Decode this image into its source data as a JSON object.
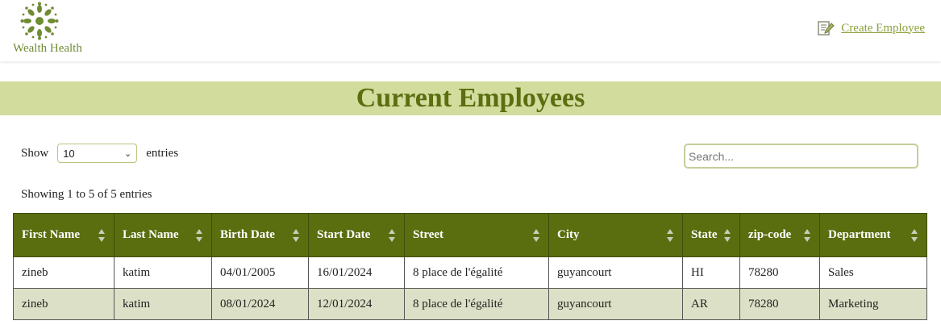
{
  "brand": {
    "name": "Wealth Health"
  },
  "nav": {
    "create_label": "Create Employee"
  },
  "page": {
    "title": "Current Employees"
  },
  "controls": {
    "show_label": "Show",
    "entries_value": "10",
    "entries_label": "entries",
    "search_placeholder": "Search...",
    "showing_text": "Showing 1 to 5 of 5 entries"
  },
  "table": {
    "columns": [
      "First Name",
      "Last Name",
      "Birth Date",
      "Start Date",
      "Street",
      "City",
      "State",
      "zip-code",
      "Department"
    ],
    "rows": [
      [
        "zineb",
        "katim",
        "04/01/2005",
        "16/01/2024",
        "8 place de l'égalité",
        "guyancourt",
        "HI",
        "78280",
        "Sales"
      ],
      [
        "zineb",
        "katim",
        "08/01/2024",
        "12/01/2024",
        "8 place de l'égalité",
        "guyancourt",
        "AR",
        "78280",
        "Marketing"
      ]
    ]
  },
  "colors": {
    "header_bg": "#5a6e0f",
    "title_band": "#d1dc9d",
    "title_text": "#5b6e10",
    "link": "#8aa13c",
    "even_row": "#dce0c6"
  }
}
